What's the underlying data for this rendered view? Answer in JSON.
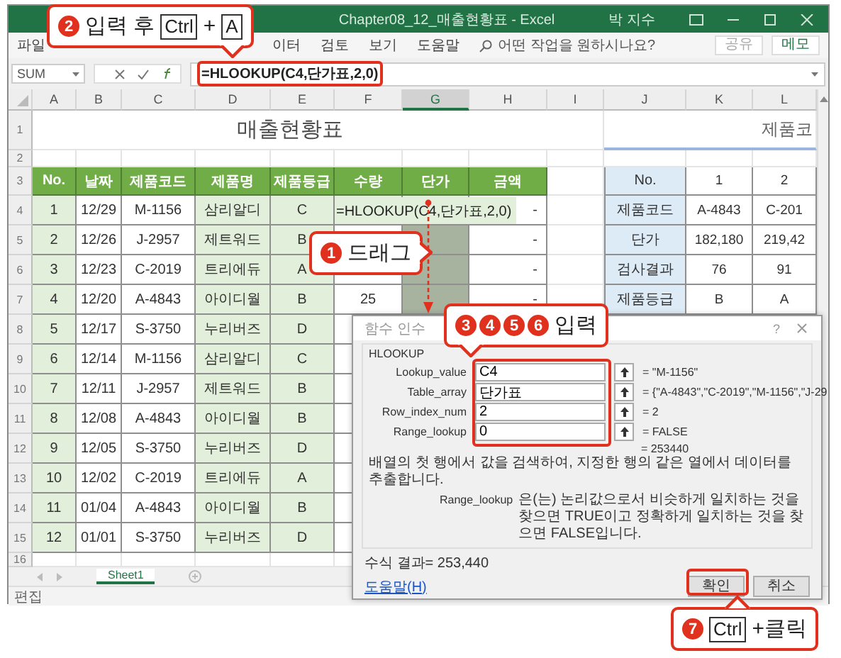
{
  "window": {
    "title": "Chapter08_12_매출현황표 - Excel",
    "user": "박 지수"
  },
  "ribbon": {
    "tabs": [
      "파일",
      "이터",
      "검토",
      "보기",
      "도움말"
    ],
    "search_placeholder": "어떤 작업을 원하시나요?",
    "share_button": "공유",
    "memo_button": "메모"
  },
  "formula_bar": {
    "name_box": "SUM",
    "formula": "=HLOOKUP(C4,단가표,2,0)"
  },
  "columns": [
    "A",
    "B",
    "C",
    "D",
    "E",
    "F",
    "G",
    "H",
    "I",
    "J",
    "K",
    "L"
  ],
  "row_numbers": [
    "1",
    "2",
    "3",
    "4",
    "5",
    "6",
    "7",
    "8",
    "9",
    "10",
    "11",
    "12",
    "13",
    "14",
    "15",
    "16"
  ],
  "sheet_title": "매출현황표",
  "side_title": "제품코",
  "sales_table": {
    "columns": [
      "No.",
      "날짜",
      "제품코드",
      "제품명",
      "제품등급",
      "수량",
      "단가",
      "금액"
    ],
    "rows": [
      {
        "cells": [
          "1",
          "12/29",
          "M-1156",
          "삼리알디",
          "C"
        ],
        "formula": "=HLOOKUP(C4,단가표,2,0)",
        "amount": "-"
      },
      {
        "cells": [
          "2",
          "12/26",
          "J-2957",
          "제트워드",
          "B"
        ],
        "selected": true,
        "amount": "-"
      },
      {
        "cells": [
          "3",
          "12/23",
          "C-2019",
          "트리에듀",
          "A"
        ],
        "selected": true,
        "amount": "-"
      },
      {
        "cells": [
          "4",
          "12/20",
          "A-4843",
          "아이디월",
          "B"
        ],
        "quantity": "25",
        "selected": true,
        "amount": "-"
      },
      {
        "cells": [
          "5",
          "12/17",
          "S-3750",
          "누리버즈",
          "D"
        ]
      },
      {
        "cells": [
          "6",
          "12/14",
          "M-1156",
          "삼리알디",
          "C"
        ]
      },
      {
        "cells": [
          "7",
          "12/11",
          "J-2957",
          "제트워드",
          "B"
        ]
      },
      {
        "cells": [
          "8",
          "12/08",
          "A-4843",
          "아이디월",
          "B"
        ]
      },
      {
        "cells": [
          "9",
          "12/05",
          "S-3750",
          "누리버즈",
          "D"
        ]
      },
      {
        "cells": [
          "10",
          "12/02",
          "C-2019",
          "트리에듀",
          "A"
        ]
      },
      {
        "cells": [
          "11",
          "01/04",
          "A-4843",
          "아이디월",
          "B"
        ]
      },
      {
        "cells": [
          "12",
          "01/01",
          "S-3750",
          "누리버즈",
          "D"
        ]
      }
    ]
  },
  "product_table": {
    "rows": [
      {
        "label": "No.",
        "values": [
          "1",
          "2"
        ]
      },
      {
        "label": "제품코드",
        "values": [
          "A-4843",
          "C-201"
        ]
      },
      {
        "label": "단가",
        "values": [
          "182,180",
          "219,42"
        ]
      },
      {
        "label": "검사결과",
        "values": [
          "76",
          "91"
        ]
      },
      {
        "label": "제품등급",
        "values": [
          "B",
          "A"
        ]
      }
    ]
  },
  "dialog": {
    "title": "함수 인수",
    "help_button": "?",
    "function": "HLOOKUP",
    "args": [
      {
        "label": "Lookup_value",
        "value": "C4",
        "result": "= \"M-1156\""
      },
      {
        "label": "Table_array",
        "value": "단가표",
        "result": "= {\"A-4843\",\"C-2019\",\"M-1156\",\"J-29"
      },
      {
        "label": "Row_index_num",
        "value": "2",
        "result": "= 2"
      },
      {
        "label": "Range_lookup",
        "value": "0",
        "result": "= FALSE"
      }
    ],
    "result": "= 253440",
    "description": "배열의 첫 행에서 값을 검색하여, 지정한 행의 같은 열에서 데이터를 추출합니다.",
    "arg_label": "Range_lookup",
    "arg_description": "은(는) 논리값으로서 비슷하게 일치하는 것을 찾으면 TRUE이고 정확하게 일치하는 것을 찾으면 FALSE입니다.",
    "formula_result": "수식 결과= 253,440",
    "help_link": "도움말(H)",
    "buttons": [
      "확인",
      "취소"
    ]
  },
  "sheet_tabs": [
    {
      "label": "Sheet1",
      "selected": true
    }
  ],
  "status": "편집",
  "callouts": [
    {
      "steps": [
        "2"
      ],
      "parts": [
        {
          "kind": "text",
          "text": "입력 후"
        },
        {
          "kind": "key",
          "text": "Ctrl"
        },
        {
          "kind": "text",
          "text": "+"
        },
        {
          "kind": "key",
          "text": "A"
        }
      ]
    },
    {
      "steps": [
        "1"
      ],
      "parts": [
        {
          "kind": "text",
          "text": "드래그"
        }
      ]
    },
    {
      "steps": [
        "3",
        "4",
        "5",
        "6"
      ],
      "parts": [
        {
          "kind": "text",
          "text": "입력"
        }
      ]
    },
    {
      "steps": [
        "7"
      ],
      "parts": [
        {
          "kind": "key",
          "text": "Ctrl"
        },
        {
          "kind": "text",
          "text": "+클릭"
        }
      ]
    }
  ]
}
